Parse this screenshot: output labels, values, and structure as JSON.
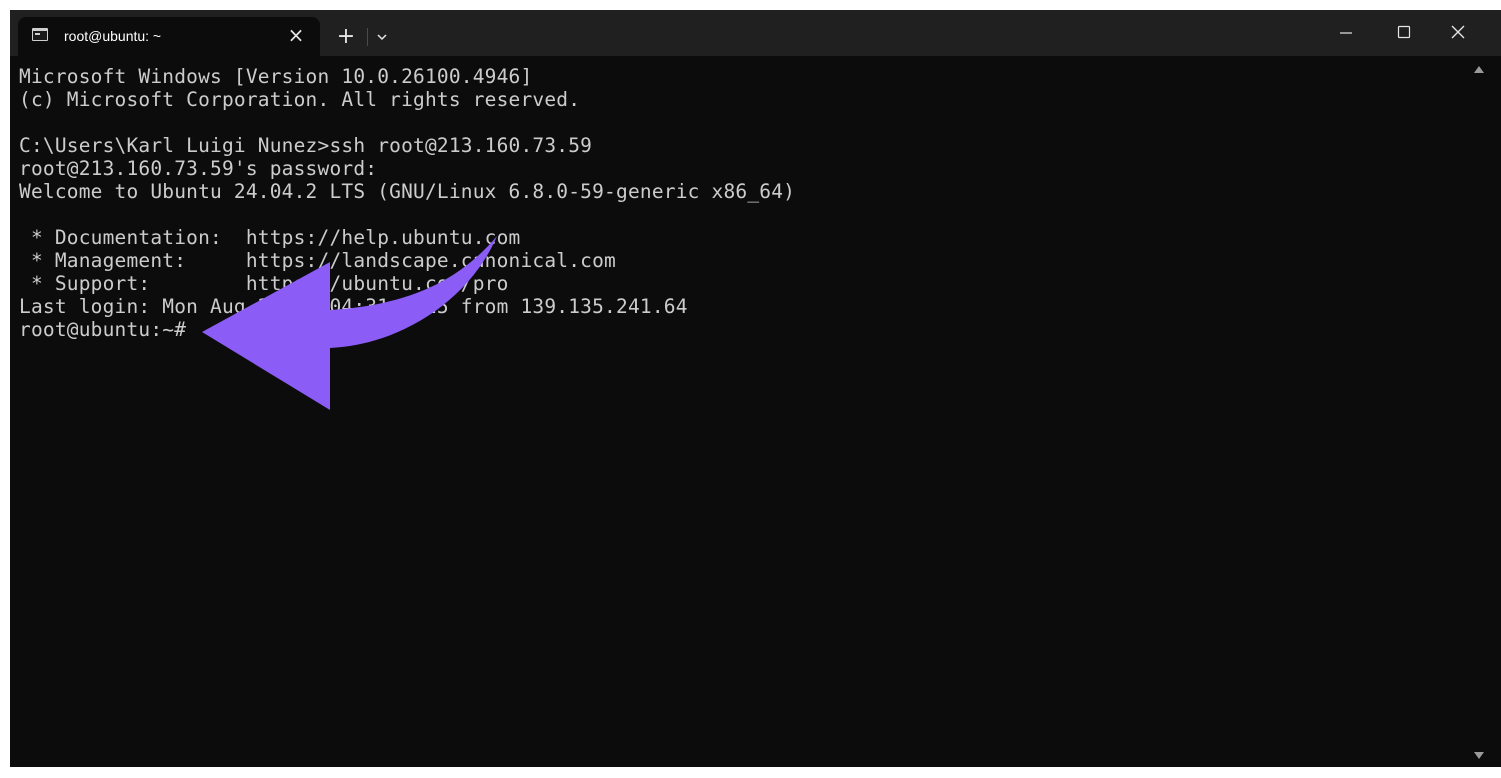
{
  "tab": {
    "title": "root@ubuntu: ~",
    "icon": "terminal-icon",
    "close_label": "×"
  },
  "titlebar": {
    "new_tab_label": "+"
  },
  "window_controls": {
    "minimize_icon": "minimize-icon",
    "maximize_icon": "maximize-icon",
    "close_icon": "close-icon"
  },
  "terminal": {
    "lines": [
      "Microsoft Windows [Version 10.0.26100.4946]",
      "(c) Microsoft Corporation. All rights reserved.",
      "",
      "C:\\Users\\Karl Luigi Nunez>ssh root@213.160.73.59",
      "root@213.160.73.59's password:",
      "Welcome to Ubuntu 24.04.2 LTS (GNU/Linux 6.8.0-59-generic x86_64)",
      "",
      " * Documentation:  https://help.ubuntu.com",
      " * Management:     https://landscape.canonical.com",
      " * Support:        https://ubuntu.com/pro",
      "Last login: Mon Aug 25 07:04:31 2025 from 139.135.241.64",
      "root@ubuntu:~#"
    ]
  },
  "colors": {
    "terminal_bg": "#0c0c0c",
    "titlebar_bg": "#202020",
    "text": "#cccccc",
    "annotation_arrow": "#8b5cf6"
  }
}
